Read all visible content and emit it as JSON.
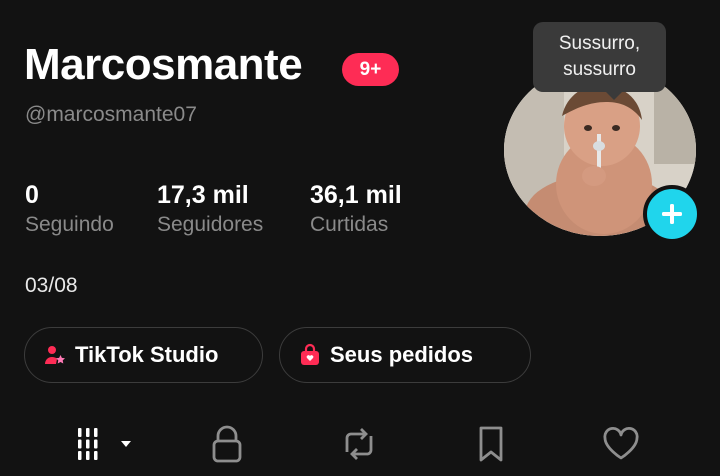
{
  "profile": {
    "display_name": "Marcosmante",
    "notification_badge": "9+",
    "username": "@marcosmante07",
    "bio_date": "03/08"
  },
  "stats": [
    {
      "value": "0",
      "label": "Seguindo"
    },
    {
      "value": "17,3 mil",
      "label": "Seguidores"
    },
    {
      "value": "36,1 mil",
      "label": "Curtidas"
    }
  ],
  "buttons": {
    "studio_label": "TikTok Studio",
    "orders_label": "Seus pedidos"
  },
  "tooltip": {
    "line1": "Sussurro,",
    "line2": "sussurro"
  },
  "tabs": [
    {
      "icon": "grid-icon"
    },
    {
      "icon": "lock-icon"
    },
    {
      "icon": "repost-icon"
    },
    {
      "icon": "bookmark-icon"
    },
    {
      "icon": "heart-icon"
    }
  ],
  "colors": {
    "background": "#121212",
    "badge": "#fe2c55",
    "add_button": "#20d5ec",
    "secondary_text": "#8a8a8a"
  }
}
